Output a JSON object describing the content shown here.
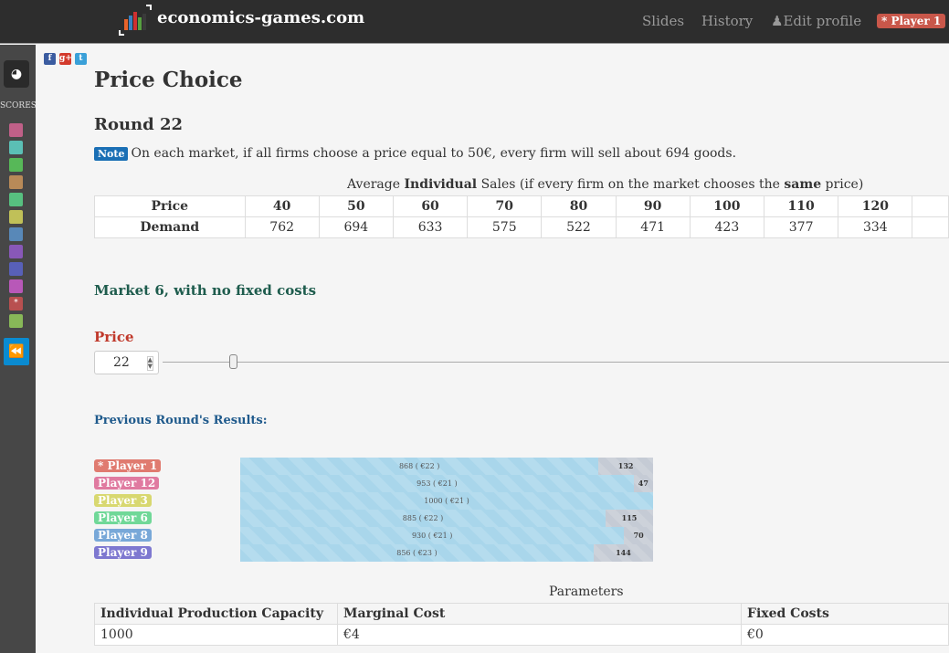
{
  "header": {
    "brand": "economics-games.com",
    "nav": [
      "Slides",
      "History",
      "Edit profile"
    ],
    "player": "* Player 1"
  },
  "sidebar": {
    "scores_label": "SCORES",
    "colors": [
      "#c06088",
      "#5bbfb5",
      "#57b858",
      "#b88a58",
      "#57c080",
      "#c0c058",
      "#5888b8",
      "#8858b8",
      "#5860b8",
      "#b858b8",
      "#b85050",
      "#88b858"
    ],
    "starred_index": 10,
    "star": "*"
  },
  "social": [
    "f",
    "g+",
    "t"
  ],
  "page": {
    "title": "Price Choice",
    "round": "Round 22",
    "note_label": "Note",
    "note": "On each market, if all firms choose a price equal to 50€, every firm will sell about 694 goods."
  },
  "sales": {
    "caption_pre": "Average ",
    "caption_b1": "Individual",
    "caption_mid": " Sales (if every firm on the market chooses the ",
    "caption_b2": "same",
    "caption_post": " price)",
    "price_label": "Price",
    "demand_label": "Demand",
    "prices": [
      "40",
      "50",
      "60",
      "70",
      "80",
      "90",
      "100",
      "110",
      "120"
    ],
    "demand": [
      "762",
      "694",
      "633",
      "575",
      "522",
      "471",
      "423",
      "377",
      "334"
    ]
  },
  "market": {
    "title": "Market 6, with no fixed costs",
    "price_label": "Price",
    "price_value": "22",
    "slider_fraction": 0.09
  },
  "results": {
    "title": "Previous Round's Results:",
    "capacity": 1000,
    "rows": [
      {
        "player": "* Player 1",
        "color": "#e07b70",
        "sold": 868,
        "price": "€22",
        "unsold": "132"
      },
      {
        "player": "Player 12",
        "color": "#e07aa0",
        "sold": 953,
        "price": "€21",
        "unsold": "47"
      },
      {
        "player": "Player 3",
        "color": "#d8d870",
        "sold": 1000,
        "price": "€21",
        "unsold": ""
      },
      {
        "player": "Player 6",
        "color": "#70d898",
        "sold": 885,
        "price": "€22",
        "unsold": "115"
      },
      {
        "player": "Player 8",
        "color": "#78a8d8",
        "sold": 930,
        "price": "€21",
        "unsold": "70"
      },
      {
        "player": "Player 9",
        "color": "#7e78d0",
        "sold": 856,
        "price": "€23",
        "unsold": "144"
      }
    ]
  },
  "parameters": {
    "caption": "Parameters",
    "headers": [
      "Individual Production Capacity",
      "Marginal Cost",
      "Fixed Costs"
    ],
    "values": [
      "1000",
      "€4",
      "€0"
    ]
  }
}
